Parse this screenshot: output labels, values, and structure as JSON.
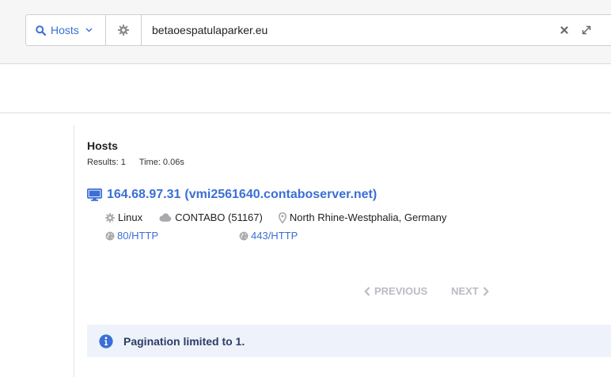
{
  "search": {
    "type_label": "Hosts",
    "query": "betaoespatulaparker.eu"
  },
  "results": {
    "title": "Hosts",
    "count_text": "Results: 1",
    "time_text": "Time: 0.06s"
  },
  "host": {
    "ip": "164.68.97.31",
    "hostname": "(vmi2561640.contaboserver.net)",
    "os": "Linux",
    "asn": "CONTABO (51167)",
    "location": "North Rhine-Westphalia, Germany",
    "ports": [
      "80/HTTP",
      "443/HTTP"
    ]
  },
  "pagination": {
    "previous_label": "PREVIOUS",
    "next_label": "NEXT"
  },
  "notice": {
    "text": "Pagination limited to 1."
  },
  "colors": {
    "accent": "#3b6fd6",
    "muted": "#b9bcc2",
    "notice_bg": "#eef2fb",
    "notice_text": "#2c3d66"
  }
}
